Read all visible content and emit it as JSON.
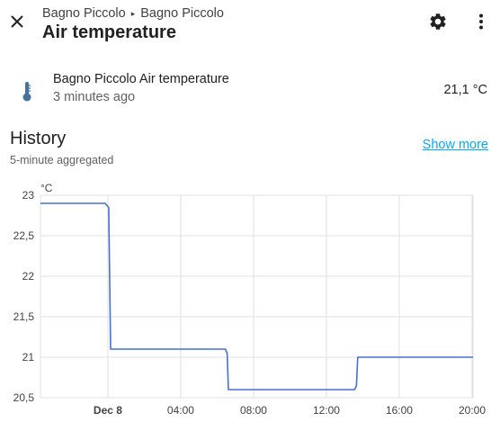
{
  "header": {
    "close_icon": "close-icon",
    "breadcrumb": [
      "Bagno Piccolo",
      "Bagno Piccolo"
    ],
    "breadcrumb_separator": "▸",
    "title": "Air temperature",
    "settings_icon": "gear-icon",
    "more_icon": "more-vertical-icon"
  },
  "entity": {
    "icon": "thermometer-icon",
    "name": "Bagno Piccolo Air temperature",
    "last_changed": "3 minutes ago",
    "state": "21,1 °C"
  },
  "history": {
    "title": "History",
    "subtitle": "5-minute aggregated",
    "show_more": "Show more"
  },
  "colors": {
    "line": "#4a6fd0",
    "grid": "#e0e0e0",
    "link": "#03a9f4"
  },
  "chart_data": {
    "type": "line",
    "ylabel": "°C",
    "ylim": [
      20.5,
      23
    ],
    "yticks": [
      "20,5",
      "21",
      "21,5",
      "22",
      "22,5",
      "23"
    ],
    "ytick_values": [
      20.5,
      21,
      21.5,
      22,
      22.5,
      23
    ],
    "xlim_hours": [
      -3.7,
      20.05
    ],
    "xticks": [
      {
        "label": "Dec 8",
        "hour": 0,
        "bold": true
      },
      {
        "label": "04:00",
        "hour": 4,
        "bold": false
      },
      {
        "label": "08:00",
        "hour": 8,
        "bold": false
      },
      {
        "label": "12:00",
        "hour": 12,
        "bold": false
      },
      {
        "label": "16:00",
        "hour": 16,
        "bold": false
      },
      {
        "label": "20:00",
        "hour": 20,
        "bold": false
      }
    ],
    "series": [
      {
        "points": [
          [
            -3.7,
            22.9
          ],
          [
            -0.15,
            22.9
          ],
          [
            0.05,
            22.85
          ],
          [
            0.15,
            21.1
          ],
          [
            6.45,
            21.1
          ],
          [
            6.55,
            21.05
          ],
          [
            6.62,
            20.6
          ],
          [
            13.55,
            20.6
          ],
          [
            13.65,
            20.65
          ],
          [
            13.72,
            21.0
          ],
          [
            20.05,
            21.0
          ]
        ]
      }
    ]
  }
}
